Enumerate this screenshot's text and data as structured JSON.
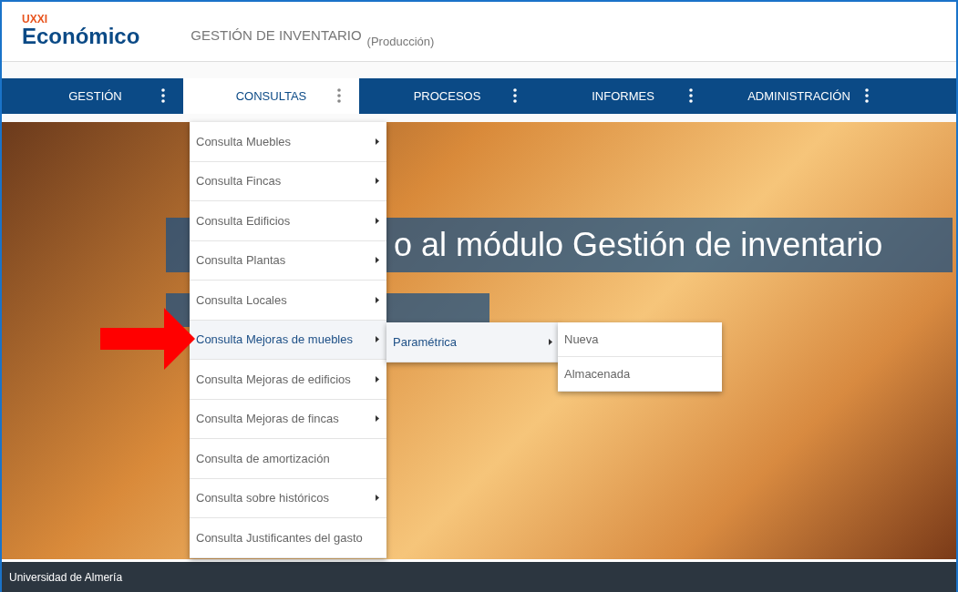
{
  "header": {
    "brand_top": "UXXI",
    "brand": "Económico",
    "module": "GESTIÓN DE INVENTARIO",
    "environment": "(Producción)"
  },
  "nav": {
    "tabs": [
      {
        "label": "GESTIÓN",
        "selected": false
      },
      {
        "label": "CONSULTAS",
        "selected": true
      },
      {
        "label": "PROCESOS",
        "selected": false
      },
      {
        "label": "INFORMES",
        "selected": false
      },
      {
        "label": "ADMINISTRACIÓN",
        "selected": false
      }
    ]
  },
  "banner": {
    "title": "o al módulo Gestión de inventario"
  },
  "menu": {
    "items": [
      {
        "label": "Consulta Muebles",
        "has_submenu": true,
        "selected": false
      },
      {
        "label": "Consulta Fincas",
        "has_submenu": true,
        "selected": false
      },
      {
        "label": "Consulta Edificios",
        "has_submenu": true,
        "selected": false
      },
      {
        "label": "Consulta Plantas",
        "has_submenu": true,
        "selected": false
      },
      {
        "label": "Consulta Locales",
        "has_submenu": true,
        "selected": false
      },
      {
        "label": "Consulta Mejoras de muebles",
        "has_submenu": true,
        "selected": true
      },
      {
        "label": "Consulta Mejoras de edificios",
        "has_submenu": true,
        "selected": false
      },
      {
        "label": "Consulta Mejoras de fincas",
        "has_submenu": true,
        "selected": false
      },
      {
        "label": "Consulta de amortización",
        "has_submenu": false,
        "selected": false
      },
      {
        "label": "Consulta sobre históricos",
        "has_submenu": true,
        "selected": false
      },
      {
        "label": "Consulta Justificantes del gasto",
        "has_submenu": false,
        "selected": false
      }
    ]
  },
  "submenu": {
    "items": [
      {
        "label": "Paramétrica",
        "has_submenu": true,
        "selected": true
      }
    ]
  },
  "subsubmenu": {
    "items": [
      {
        "label": "Nueva",
        "has_submenu": false,
        "selected": false
      },
      {
        "label": "Almacenada",
        "has_submenu": false,
        "selected": false
      }
    ]
  },
  "footer": {
    "text": "Universidad de Almería"
  }
}
